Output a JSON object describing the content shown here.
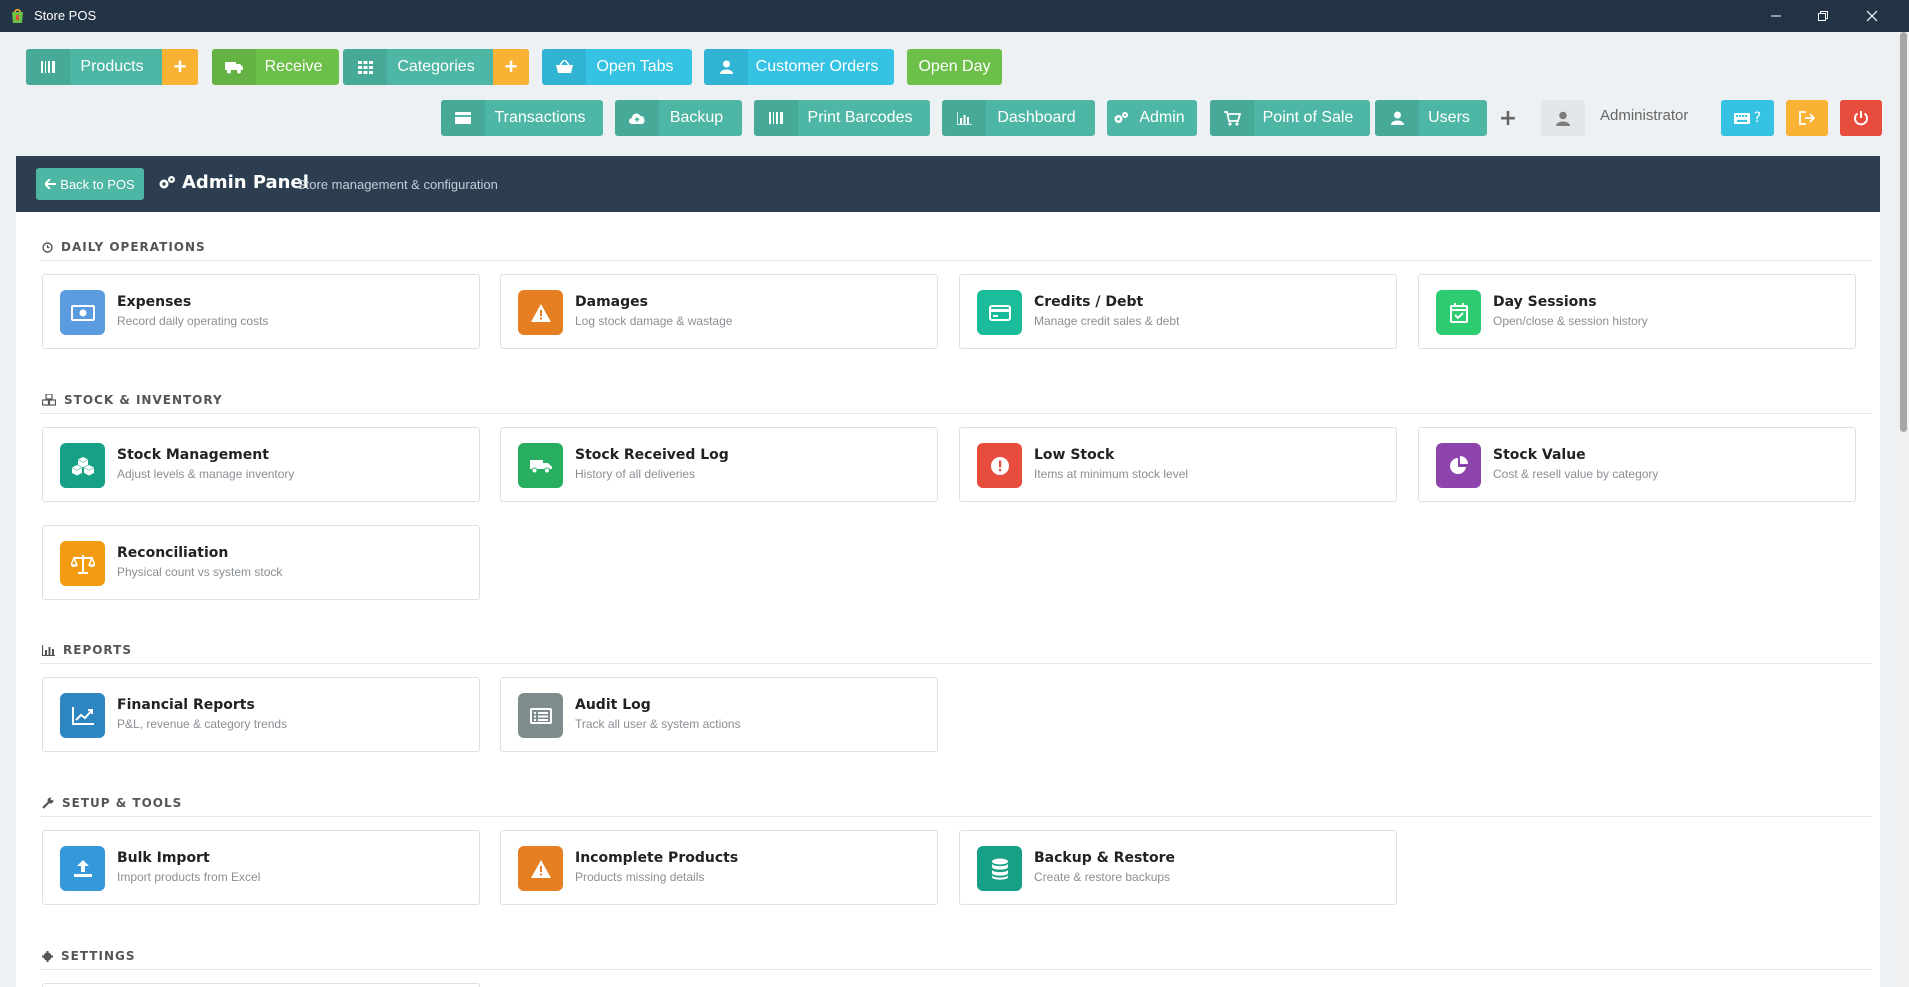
{
  "window": {
    "title": "Store POS"
  },
  "toolbar_row1": [
    {
      "name": "products-button",
      "label": "Products",
      "icon": "barcode-icon",
      "color": "#4db6a4",
      "add": true
    },
    {
      "name": "receive-button",
      "label": "Receive",
      "icon": "truck-icon",
      "color": "#6cc04a",
      "add": false
    },
    {
      "name": "categories-button",
      "label": "Categories",
      "icon": "grid-icon",
      "color": "#4db6a4",
      "add": true
    },
    {
      "name": "open-tabs-button",
      "label": "Open Tabs",
      "icon": "basket-icon",
      "color": "#35c2e3",
      "add": false
    },
    {
      "name": "customer-orders-button",
      "label": "Customer Orders",
      "icon": "user-icon",
      "color": "#35c2e3",
      "add": false
    },
    {
      "name": "open-day-button",
      "label": "Open Day",
      "icon": "",
      "color": "#6cc04a",
      "add": false
    }
  ],
  "toolbar_row2": [
    {
      "name": "transactions-button",
      "label": "Transactions",
      "icon": "card-icon"
    },
    {
      "name": "backup-button",
      "label": "Backup",
      "icon": "cloud-upload-icon"
    },
    {
      "name": "print-barcodes-button",
      "label": "Print Barcodes",
      "icon": "barcode-icon"
    },
    {
      "name": "dashboard-button",
      "label": "Dashboard",
      "icon": "bar-chart-icon"
    },
    {
      "name": "admin-button",
      "label": "Admin",
      "icon": "gears-icon"
    },
    {
      "name": "point-of-sale-button",
      "label": "Point of Sale",
      "icon": "cart-icon"
    },
    {
      "name": "users-button",
      "label": "Users",
      "icon": "user-icon"
    }
  ],
  "user": {
    "name": "Administrator"
  },
  "help_button": {
    "label": "?"
  },
  "panel": {
    "back_label": "Back to POS",
    "title": "Admin Panel",
    "subtitle": "Store management & configuration"
  },
  "sections": [
    {
      "name": "daily-operations",
      "title": "DAILY OPERATIONS",
      "icon": "clock-icon",
      "cards": [
        {
          "name": "expenses",
          "title": "Expenses",
          "sub": "Record daily operating costs",
          "icon": "money-icon",
          "color": "#5b9bdf"
        },
        {
          "name": "damages",
          "title": "Damages",
          "sub": "Log stock damage & wastage",
          "icon": "warning-icon",
          "color": "#e67e22"
        },
        {
          "name": "credits-debt",
          "title": "Credits / Debt",
          "sub": "Manage credit sales & debt",
          "icon": "credit-card-icon",
          "color": "#1abc9c"
        },
        {
          "name": "day-sessions",
          "title": "Day Sessions",
          "sub": "Open/close & session history",
          "icon": "calendar-check-icon",
          "color": "#2ecc71"
        }
      ]
    },
    {
      "name": "stock-inventory",
      "title": "STOCK & INVENTORY",
      "icon": "cubes-icon",
      "cards": [
        {
          "name": "stock-management",
          "title": "Stock Management",
          "sub": "Adjust levels & manage inventory",
          "icon": "cubes-icon",
          "color": "#16a085"
        },
        {
          "name": "stock-received-log",
          "title": "Stock Received Log",
          "sub": "History of all deliveries",
          "icon": "truck-icon",
          "color": "#27ae60"
        },
        {
          "name": "low-stock",
          "title": "Low Stock",
          "sub": "Items at minimum stock level",
          "icon": "alert-circle-icon",
          "color": "#e74c3c"
        },
        {
          "name": "stock-value",
          "title": "Stock Value",
          "sub": "Cost & resell value by category",
          "icon": "pie-chart-icon",
          "color": "#8e44ad"
        },
        {
          "name": "reconciliation",
          "title": "Reconciliation",
          "sub": "Physical count vs system stock",
          "icon": "balance-scale-icon",
          "color": "#f39c12"
        }
      ]
    },
    {
      "name": "reports",
      "title": "REPORTS",
      "icon": "bar-chart-icon",
      "cards": [
        {
          "name": "financial-reports",
          "title": "Financial Reports",
          "sub": "P&L, revenue & category trends",
          "icon": "line-chart-icon",
          "color": "#2e86c1"
        },
        {
          "name": "audit-log",
          "title": "Audit Log",
          "sub": "Track all user & system actions",
          "icon": "list-alt-icon",
          "color": "#7f8c8d"
        }
      ]
    },
    {
      "name": "setup-tools",
      "title": "SETUP & TOOLS",
      "icon": "wrench-icon",
      "cards": [
        {
          "name": "bulk-import",
          "title": "Bulk Import",
          "sub": "Import products from Excel",
          "icon": "upload-icon",
          "color": "#3498db"
        },
        {
          "name": "incomplete-products",
          "title": "Incomplete Products",
          "sub": "Products missing details",
          "icon": "warning-icon",
          "color": "#e67e22"
        },
        {
          "name": "backup-restore",
          "title": "Backup & Restore",
          "sub": "Create & restore backups",
          "icon": "database-icon",
          "color": "#16a085"
        }
      ]
    },
    {
      "name": "settings",
      "title": "SETTINGS",
      "icon": "gear-icon",
      "cards": []
    }
  ]
}
